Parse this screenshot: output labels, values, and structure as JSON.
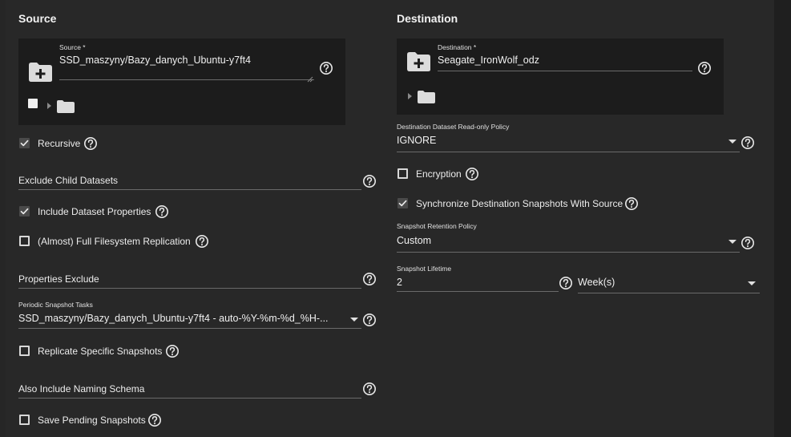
{
  "source": {
    "title": "Source",
    "path_label": "Source *",
    "path_value": "SSD_maszyny/Bazy_danych_Ubuntu-y7ft4",
    "recursive_label": "Recursive",
    "exclude_child_label": "Exclude Child Datasets",
    "include_props_label": "Include Dataset Properties",
    "full_fs_label": "(Almost) Full Filesystem Replication",
    "props_exclude_label": "Properties Exclude",
    "periodic_tasks_label": "Periodic Snapshot Tasks",
    "periodic_tasks_value": "SSD_maszyny/Bazy_danych_Ubuntu-y7ft4 - auto-%Y-%m-%d_%H-...",
    "replicate_specific_label": "Replicate Specific Snapshots",
    "naming_schema_label": "Also Include Naming Schema",
    "save_pending_label": "Save Pending Snapshots"
  },
  "destination": {
    "title": "Destination",
    "path_label": "Destination *",
    "path_value": "Seagate_IronWolf_odz",
    "readonly_policy_label": "Destination Dataset Read-only Policy",
    "readonly_policy_value": "IGNORE",
    "encryption_label": "Encryption",
    "sync_snapshots_label": "Synchronize Destination Snapshots With Source",
    "retention_label": "Snapshot Retention Policy",
    "retention_value": "Custom",
    "lifetime_label": "Snapshot Lifetime",
    "lifetime_value": "2",
    "lifetime_unit": "Week(s)"
  },
  "state": {
    "recursive": true,
    "include_props": true,
    "full_fs": false,
    "replicate_specific": false,
    "save_pending": false,
    "encryption": false,
    "sync_snapshots": true,
    "tree_checkbox": false
  },
  "icons": {
    "folder_add": "folder-plus-icon",
    "folder": "folder-icon",
    "help": "help-circle-icon",
    "expand": "caret-right-icon",
    "dropdown": "caret-down-icon",
    "check": "checkmark-icon"
  },
  "colors": {
    "background": "#1e1e1e",
    "card": "#282828",
    "explorer": "#1c1c1c",
    "text": "#e8e8e8",
    "checkbox_checked": "#4a4a4a"
  }
}
